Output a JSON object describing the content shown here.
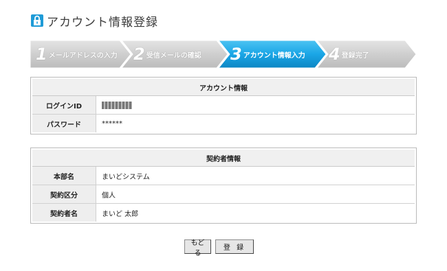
{
  "header": {
    "title": "アカウント情報登録",
    "icon": "lock-icon"
  },
  "steps": [
    {
      "number": "1",
      "label": "メールアドレスの入力",
      "active": false
    },
    {
      "number": "2",
      "label": "受信メールの確認",
      "active": false
    },
    {
      "number": "3",
      "label": "アカウント情報入力",
      "active": true
    },
    {
      "number": "4",
      "label": "登録完了",
      "active": false
    }
  ],
  "account": {
    "heading": "アカウント情報",
    "login_id_label": "ログインID",
    "login_id_value": "",
    "password_label": "パスワード",
    "password_value": "******"
  },
  "contractor": {
    "heading": "契約者情報",
    "division_label": "本部名",
    "division_value": "まいどシステム",
    "type_label": "契約区分",
    "type_value": "個人",
    "name_label": "契約者名",
    "name_value": "まいど 太郎"
  },
  "actions": {
    "back_label": "もどる",
    "register_label": "登 録"
  },
  "colors": {
    "active_step": "#1aa6e6",
    "inactive_step": "#c8c8c8",
    "accent_icon": "#1f9bd7"
  }
}
